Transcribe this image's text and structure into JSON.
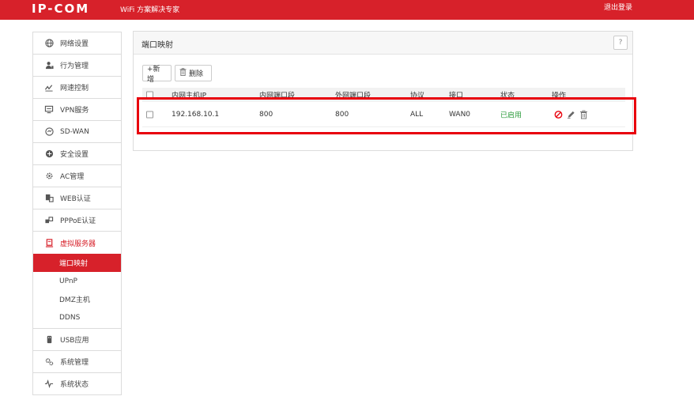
{
  "header": {
    "logo": "IP-COM",
    "tagline": "WiFi 方案解决专家",
    "logout": "退出登录"
  },
  "sidebar": {
    "items": [
      {
        "label": "网络设置",
        "icon": "globe-icon"
      },
      {
        "label": "行为管理",
        "icon": "user-icon"
      },
      {
        "label": "网速控制",
        "icon": "speed-icon"
      },
      {
        "label": "VPN服务",
        "icon": "monitor-icon"
      },
      {
        "label": "SD-WAN",
        "icon": "sdwan-icon"
      },
      {
        "label": "安全设置",
        "icon": "shield-icon"
      },
      {
        "label": "AC管理",
        "icon": "ac-gear-icon"
      },
      {
        "label": "WEB认证",
        "icon": "web-auth-icon"
      },
      {
        "label": "PPPoE认证",
        "icon": "pppoe-icon"
      },
      {
        "label": "虚拟服务器",
        "icon": "server-icon"
      },
      {
        "label": "USB应用",
        "icon": "usb-icon"
      },
      {
        "label": "系统管理",
        "icon": "gears-icon"
      },
      {
        "label": "系统状态",
        "icon": "pulse-icon"
      }
    ],
    "sub_items": [
      "端口映射",
      "UPnP",
      "DMZ主机",
      "DDNS"
    ]
  },
  "panel": {
    "title": "端口映射",
    "help": "?",
    "add_label": "+新增",
    "delete_label": "删除",
    "columns": [
      "内网主机IP",
      "内网端口段",
      "外网端口段",
      "协议",
      "接口",
      "状态",
      "操作"
    ],
    "rows": [
      {
        "ip": "192.168.10.1",
        "lan_port": "800",
        "wan_port": "800",
        "protocol": "ALL",
        "interface": "WAN0",
        "status": "已启用"
      }
    ]
  },
  "colors": {
    "brand": "#d7212a",
    "highlight": "#e8000c",
    "status_enabled": "#2a9a3a"
  }
}
